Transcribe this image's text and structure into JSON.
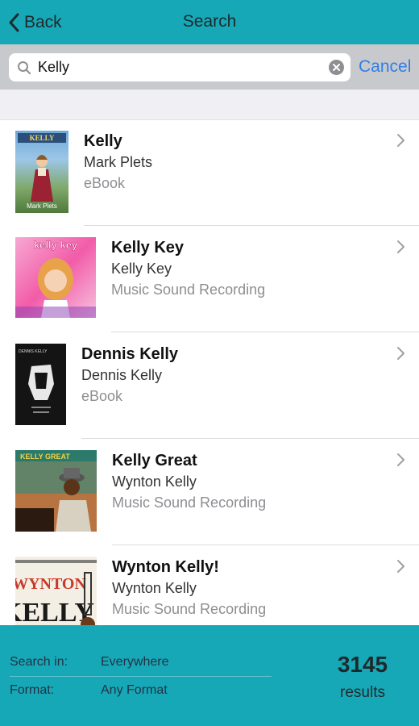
{
  "nav": {
    "back_label": "Back",
    "title": "Search"
  },
  "search": {
    "value": "Kelly",
    "placeholder": "",
    "cancel_label": "Cancel"
  },
  "results": [
    {
      "title": "Kelly",
      "author": "Mark Plets",
      "format": "eBook",
      "cover_text": "KELLY",
      "cover_sub": "Mark Plets"
    },
    {
      "title": "Kelly Key",
      "author": "Kelly Key",
      "format": "Music Sound Recording",
      "cover_text": "kelly key"
    },
    {
      "title": "Dennis Kelly",
      "author": "Dennis Kelly",
      "format": "eBook",
      "cover_text": "DENNIS KELLY"
    },
    {
      "title": "Kelly Great",
      "author": "Wynton Kelly",
      "format": "Music Sound Recording",
      "cover_text": "KELLY GREAT"
    },
    {
      "title": "Wynton Kelly!",
      "author": "Wynton Kelly",
      "format": "Music Sound Recording",
      "cover_text": "WYNTON",
      "cover_sub": "KELLY"
    }
  ],
  "footer": {
    "search_in_label": "Search in:",
    "search_in_value": "Everywhere",
    "format_label": "Format:",
    "format_value": "Any Format",
    "count": "3145",
    "count_label": "results"
  },
  "colors": {
    "accent": "#17a8b8",
    "link": "#2f7fe6",
    "searchbar_bg": "#c8c9cd"
  },
  "icons": [
    "chevron-left-icon",
    "magnifier-icon",
    "clear-icon",
    "chevron-right-icon"
  ]
}
